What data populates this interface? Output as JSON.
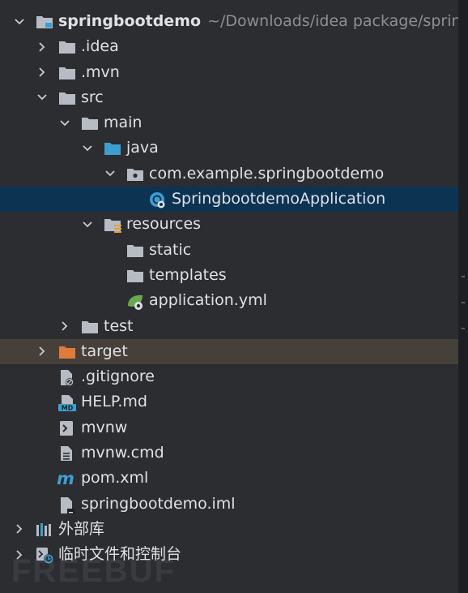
{
  "project": {
    "name": "springbootdemo",
    "path": "~/Downloads/idea package/spring"
  },
  "items": {
    "idea": ".idea",
    "mvn": ".mvn",
    "src": "src",
    "main": "main",
    "java": "java",
    "package": "com.example.springbootdemo",
    "app_class": "SpringbootdemoApplication",
    "resources": "resources",
    "static": "static",
    "templates": "templates",
    "app_yml": "application.yml",
    "test": "test",
    "target": "target",
    "gitignore": ".gitignore",
    "help_md": "HELP.md",
    "mvnw": "mvnw",
    "mvnw_cmd": "mvnw.cmd",
    "pom": "pom.xml",
    "iml": "springbootdemo.iml",
    "external_libs": "外部库",
    "scratches": "临时文件和控制台"
  },
  "icon_labels": {
    "md_badge": "MD"
  },
  "watermark": "FREEBUF",
  "colors": {
    "folder": "#b7bcc4",
    "java_folder": "#3d9fd1",
    "target_folder": "#e07b39",
    "selected_bg": "#0d3353",
    "highlight_bg": "#45403a",
    "spring_green": "#6aa84f"
  }
}
